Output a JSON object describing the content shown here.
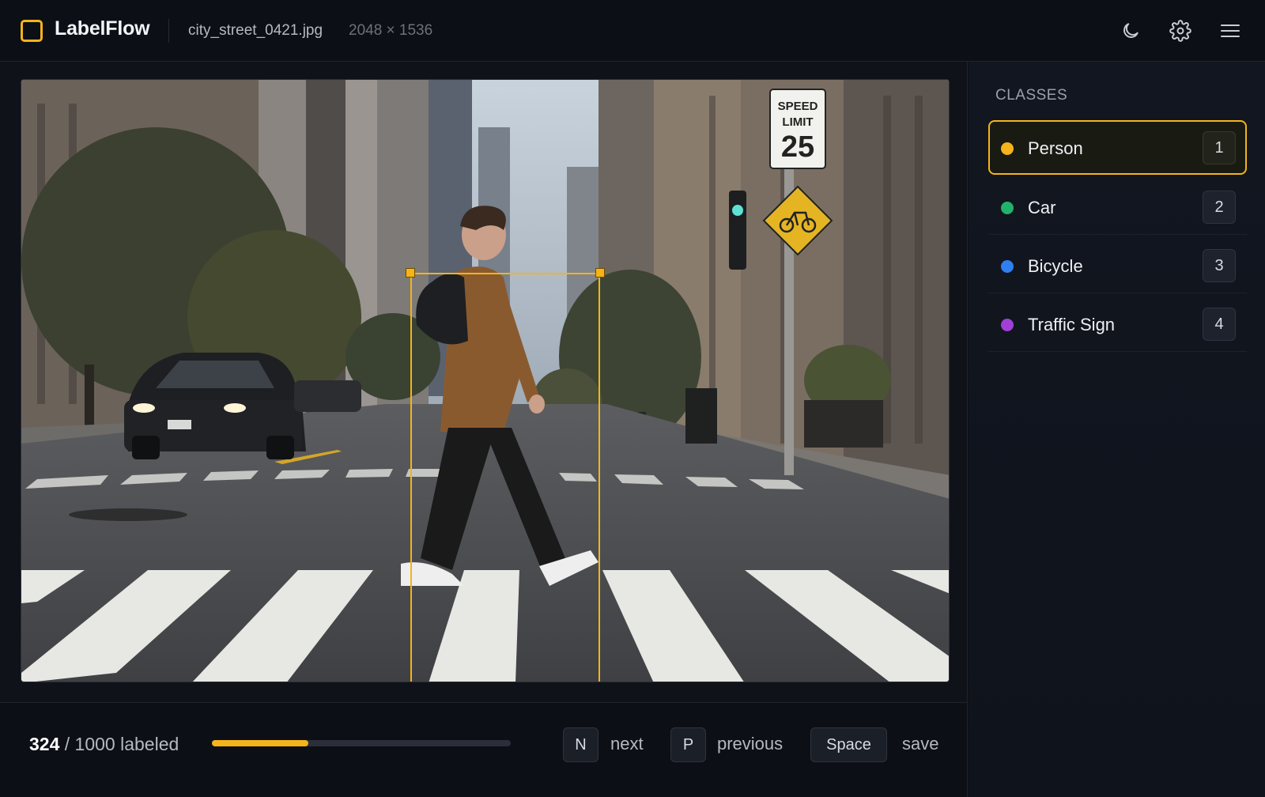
{
  "header": {
    "app_name": "LabelFlow",
    "file_name": "city_street_0421.jpg",
    "image_dims": "2048 × 1536",
    "icons": [
      "moon-icon",
      "gear-icon",
      "hamburger-menu-icon"
    ]
  },
  "theme": {
    "accent": "#f4b41a",
    "background": "#0c0f15",
    "panel": "#121620"
  },
  "annotation": {
    "active_class": "Person"
  },
  "sidebar": {
    "title": "CLASSES",
    "classes": [
      {
        "label": "Person",
        "key": "1",
        "color": "#f4b41a",
        "active": true
      },
      {
        "label": "Car",
        "key": "2",
        "color": "#22b36a",
        "active": false
      },
      {
        "label": "Bicycle",
        "key": "3",
        "color": "#2f7ff0",
        "active": false
      },
      {
        "label": "Traffic Sign",
        "key": "4",
        "color": "#a13fd6",
        "active": false
      }
    ]
  },
  "footer": {
    "labeled_count": "324",
    "total_text": "/ 1000 labeled",
    "progress_fraction": 0.324,
    "shortcuts": [
      {
        "key": "N",
        "action": "next"
      },
      {
        "key": "P",
        "action": "previous"
      },
      {
        "key": "Space",
        "action": "save"
      }
    ]
  }
}
